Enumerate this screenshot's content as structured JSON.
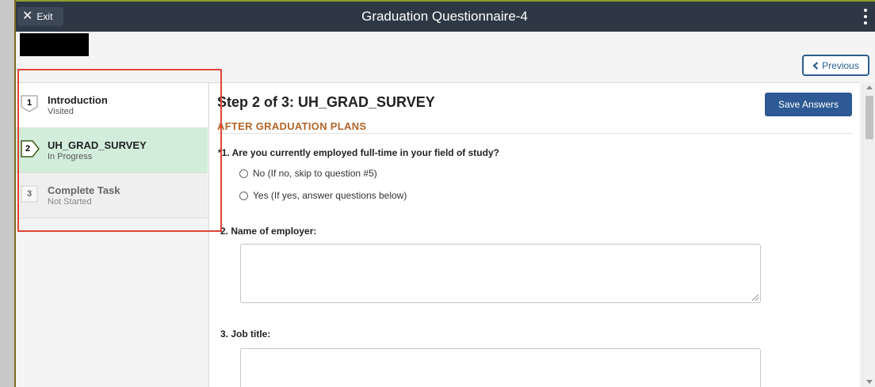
{
  "header": {
    "exit_label": "Exit",
    "title": "Graduation Questionnaire-4"
  },
  "nav": {
    "previous_label": "Previous"
  },
  "steps": [
    {
      "number": "1",
      "title": "Introduction",
      "status": "Visited"
    },
    {
      "number": "2",
      "title": "UH_GRAD_SURVEY",
      "status": "In Progress"
    },
    {
      "number": "3",
      "title": "Complete Task",
      "status": "Not Started"
    }
  ],
  "main": {
    "heading": "Step 2 of 3: UH_GRAD_SURVEY",
    "save_label": "Save Answers",
    "section_title": "AFTER GRADUATION PLANS",
    "questions": [
      {
        "text": "*1.  Are you currently employed full-time in your field of study?",
        "options": [
          "No (If no, skip to question #5)",
          "Yes (If yes, answer questions below)"
        ]
      },
      {
        "text": "2.  Name of employer:"
      },
      {
        "text": "3.  Job title:"
      }
    ]
  },
  "colors": {
    "titlebar": "#2e3845",
    "active_step": "#d2eedb",
    "section_title": "#b4652a",
    "primary_button": "#2d5a94",
    "highlight": "#e2443a"
  }
}
